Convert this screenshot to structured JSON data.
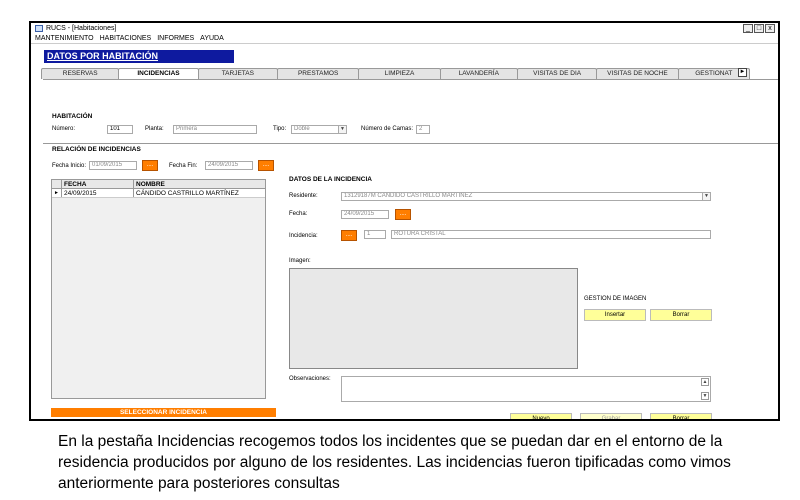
{
  "window": {
    "title": "RUCS - [Habitaciones]",
    "controls": [
      "_",
      "□",
      "x"
    ]
  },
  "menubar": [
    "MANTENIMIENTO",
    "HABITACIONES",
    "INFORMES",
    "AYUDA"
  ],
  "banner": "DATOS POR HABITACIÓN",
  "tabs": [
    "RESERVAS",
    "INCIDENCIAS",
    "TARJETAS",
    "PRESTAMOS",
    "LIMPIEZA",
    "LAVANDERÍA",
    "VISITAS DE DIA",
    "VISITAS DE NOCHE",
    "GESTIONAT"
  ],
  "active_tab": "INCIDENCIAS",
  "tab_scroll": "►",
  "habitacion": {
    "header": "HABITACIÓN",
    "numero_label": "Número:",
    "numero": "101",
    "planta_label": "Planta:",
    "planta": "Primera",
    "tipo_label": "Tipo:",
    "tipo": "Doble",
    "camas_label": "Número de Camas:",
    "camas": "2"
  },
  "relacion": {
    "header": "RELACIÓN DE INCIDENCIAS",
    "fecha_inicio_label": "Fecha Inicio:",
    "fecha_inicio": "01/09/2015",
    "fecha_fin_label": "Fecha Fin:",
    "fecha_fin": "24/09/2015",
    "picker_label": "....",
    "columns": [
      "FECHA",
      "NOMBRE"
    ],
    "rows": [
      {
        "marker": "►",
        "fecha": "24/09/2015",
        "nombre": "CÁNDIDO CASTRILLO MARTÍNEZ"
      }
    ],
    "select_button": "SELECCIONAR INCIDENCIA"
  },
  "datos": {
    "header": "DATOS DE LA INCIDENCIA",
    "residente_label": "Residente:",
    "residente": "13129187M  CÁNDIDO CASTRILLO MARTÍNEZ",
    "fecha_label": "Fecha:",
    "fecha": "24/09/2015",
    "incidencia_label": "Incidencia:",
    "incidencia_code": "1",
    "incidencia_desc": "ROTURA CRISTAL",
    "imagen_label": "Imagen:",
    "gestion_label": "GESTION DE IMAGEN",
    "insertar": "Insertar",
    "borrar_img": "Borrar",
    "observaciones_label": "Observaciones:"
  },
  "actions": {
    "nuevo": "Nuevo",
    "grabar": "Grabar",
    "borrar": "Borrar"
  },
  "caption": "En la pestaña Incidencias recogemos todos los incidentes que se puedan dar en el entorno de la residencia producidos por alguno de los residentes. Las incidencias fueron tipificadas como vimos anteriormente para posteriores consultas",
  "colors": {
    "banner": "#0e1a9f",
    "orange": "#ff7e00",
    "yellow": "#ffff99"
  }
}
